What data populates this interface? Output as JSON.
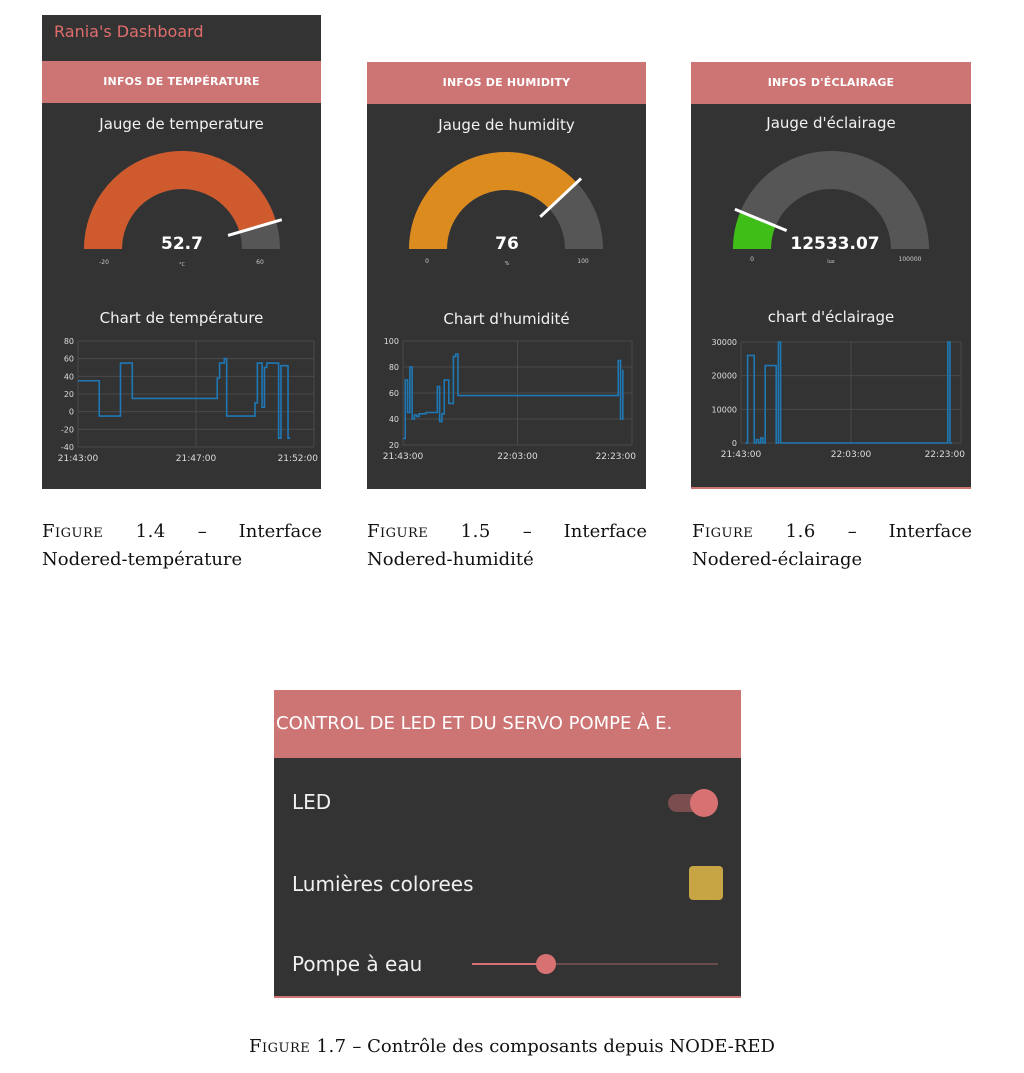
{
  "dashboard_title": "Rania's Dashboard",
  "colors": {
    "panel_bg": "#333333",
    "header_bg": "#cd7474",
    "temperature_gauge": "#cf5a2e",
    "humidity_gauge": "#dc8b1f",
    "light_gauge": "#3fbe17",
    "gauge_bg": "#565656",
    "chart_line": "#1f77b4",
    "accent": "#d87272",
    "color_swatch": "#c7a545"
  },
  "panels": [
    {
      "header": "INFOS DE TEMPÉRATURE",
      "gauge": {
        "title": "Jauge de temperature",
        "value": "52.7",
        "min": "-20",
        "max": "60",
        "unit": "°C",
        "fraction": 0.909
      },
      "chart": {
        "title": "Chart de température"
      },
      "caption": {
        "label": "Figure 1.4",
        "text": "– Interface Nodered-température"
      }
    },
    {
      "header": "INFOS DE HUMIDITY",
      "gauge": {
        "title": "Jauge de humidity",
        "value": "76",
        "min": "0",
        "max": "100",
        "unit": "%",
        "fraction": 0.76
      },
      "chart": {
        "title": "Chart d'humidité"
      },
      "caption": {
        "label": "Figure 1.5",
        "text": "– Interface Nodered-humidité"
      }
    },
    {
      "header": "INFOS D'ÉCLAIRAGE",
      "gauge": {
        "title": "Jauge d'éclairage",
        "value": "12533.07",
        "min": "0",
        "max": "100000",
        "unit": "lux",
        "fraction": 0.125
      },
      "chart": {
        "title": "chart d'éclairage"
      },
      "caption": {
        "label": "Figure 1.6",
        "text": "– Interface Nodered-éclairage"
      }
    }
  ],
  "chart_data": [
    {
      "type": "line",
      "title": "Chart de température",
      "x_ticks": [
        "21:43:00",
        "21:47:00",
        "21:52:00"
      ],
      "y_ticks": [
        "80",
        "60",
        "40",
        "20",
        "0",
        "-20",
        "-40"
      ],
      "ylim": [
        -40,
        80
      ],
      "series": [
        {
          "x": [
            0,
            0.04,
            0.08,
            0.09,
            0.12,
            0.17,
            0.18,
            0.2,
            0.21,
            0.23,
            0.29,
            0.3,
            0.55,
            0.56,
            0.59,
            0.6,
            0.62,
            0.63,
            0.64,
            0.66,
            0.68,
            0.73,
            0.74,
            0.75,
            0.76,
            0.78,
            0.79,
            0.8,
            0.82,
            0.85,
            0.86,
            0.87,
            0.88,
            0.89,
            0.9
          ],
          "y": [
            35,
            35,
            35,
            -5,
            -5,
            -5,
            55,
            55,
            55,
            15,
            15,
            15,
            15,
            15,
            38,
            55,
            60,
            -5,
            -5,
            -5,
            -5,
            -5,
            -5,
            10,
            55,
            5,
            50,
            55,
            55,
            -30,
            52,
            52,
            52,
            -30,
            -30
          ]
        }
      ]
    },
    {
      "type": "line",
      "title": "Chart d'humidité",
      "x_ticks": [
        "21:43:00",
        "22:03:00",
        "22:23:00"
      ],
      "y_ticks": [
        "100",
        "80",
        "60",
        "40",
        "20"
      ],
      "ylim": [
        20,
        100
      ],
      "series": [
        {
          "x": [
            0,
            0.01,
            0.02,
            0.03,
            0.04,
            0.05,
            0.06,
            0.07,
            0.1,
            0.15,
            0.16,
            0.17,
            0.18,
            0.2,
            0.22,
            0.23,
            0.24,
            0.25,
            0.26,
            0.3,
            0.5,
            0.7,
            0.9,
            0.93,
            0.94,
            0.95,
            0.96
          ],
          "y": [
            25,
            70,
            45,
            80,
            40,
            43,
            42,
            44,
            45,
            65,
            38,
            44,
            70,
            52,
            88,
            90,
            58,
            58,
            58,
            58,
            58,
            58,
            58,
            58,
            85,
            40,
            78
          ]
        }
      ]
    },
    {
      "type": "line",
      "title": "chart d'éclairage",
      "x_ticks": [
        "21:43:00",
        "22:03:00",
        "22:23:00"
      ],
      "y_ticks": [
        "30000",
        "20000",
        "10000",
        "0"
      ],
      "ylim": [
        0,
        30000
      ],
      "series": [
        {
          "x": [
            0.02,
            0.03,
            0.05,
            0.06,
            0.07,
            0.08,
            0.09,
            0.1,
            0.11,
            0.14,
            0.15,
            0.16,
            0.17,
            0.18,
            0.2,
            0.3,
            0.5,
            0.7,
            0.9,
            0.94,
            0.95,
            0.96
          ],
          "y": [
            0,
            26000,
            26000,
            0,
            1000,
            0,
            1500,
            0,
            23000,
            23000,
            23000,
            0,
            30000,
            0,
            0,
            0,
            0,
            0,
            0,
            30000,
            0,
            0
          ]
        }
      ]
    }
  ],
  "control": {
    "header": "CONTROL DE LED ET DU SERVO POMPE À E.",
    "led_label": "LED",
    "led_on": true,
    "color_label": "Lumières colorees",
    "pump_label": "Pompe à eau",
    "pump_level": 0.3,
    "caption_label": "Figure 1.7",
    "caption_text": "– Contrôle des composants depuis NODE-RED"
  }
}
